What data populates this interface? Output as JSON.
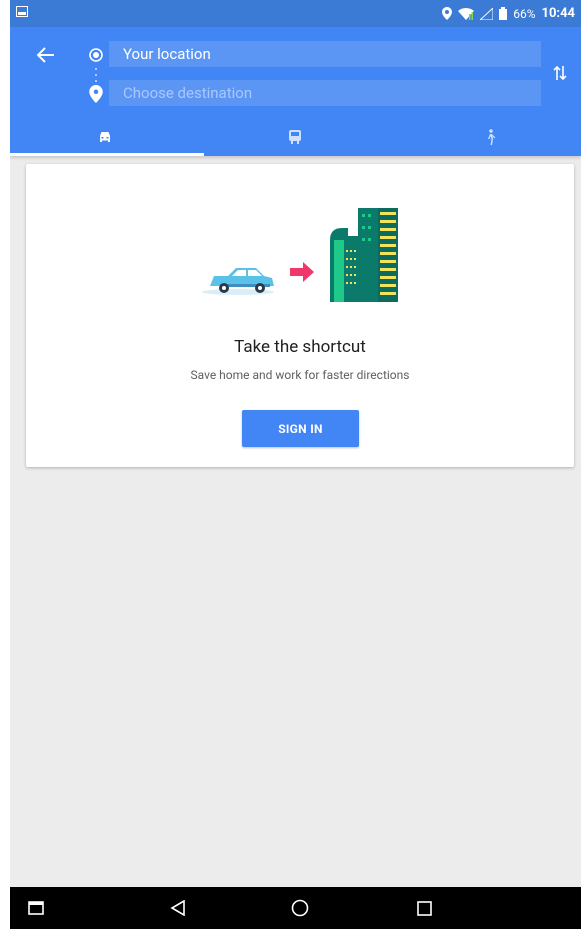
{
  "status_bar": {
    "battery_percent": "66%",
    "time": "10:44"
  },
  "directions": {
    "origin_value": "Your location",
    "destination_placeholder": "Choose destination",
    "modes": [
      "driving",
      "transit",
      "walking"
    ],
    "selected_mode": "driving"
  },
  "promo_card": {
    "title": "Take the shortcut",
    "subtitle": "Save home and work for faster directions",
    "sign_in_label": "SIGN IN"
  },
  "colors": {
    "app_bar": "#4285f4",
    "status_bar": "#3c7bd5",
    "background": "#ececec",
    "button": "#4285f4",
    "arrow_accent": "#f0386b",
    "car": "#5bc2e7",
    "building_dark": "#0c7a6b",
    "building_light": "#1ec98a",
    "building_stripe": "#f3e35b"
  },
  "icons": [
    "screenshot-icon",
    "location-pin-icon",
    "wifi-icon",
    "signal-icon",
    "battery-icon",
    "back-arrow-icon",
    "origin-dot-icon",
    "destination-pin-icon",
    "swap-icon",
    "car-icon",
    "transit-icon",
    "walk-icon",
    "recent-apps-icon",
    "nav-back-icon",
    "home-icon",
    "overview-icon"
  ]
}
